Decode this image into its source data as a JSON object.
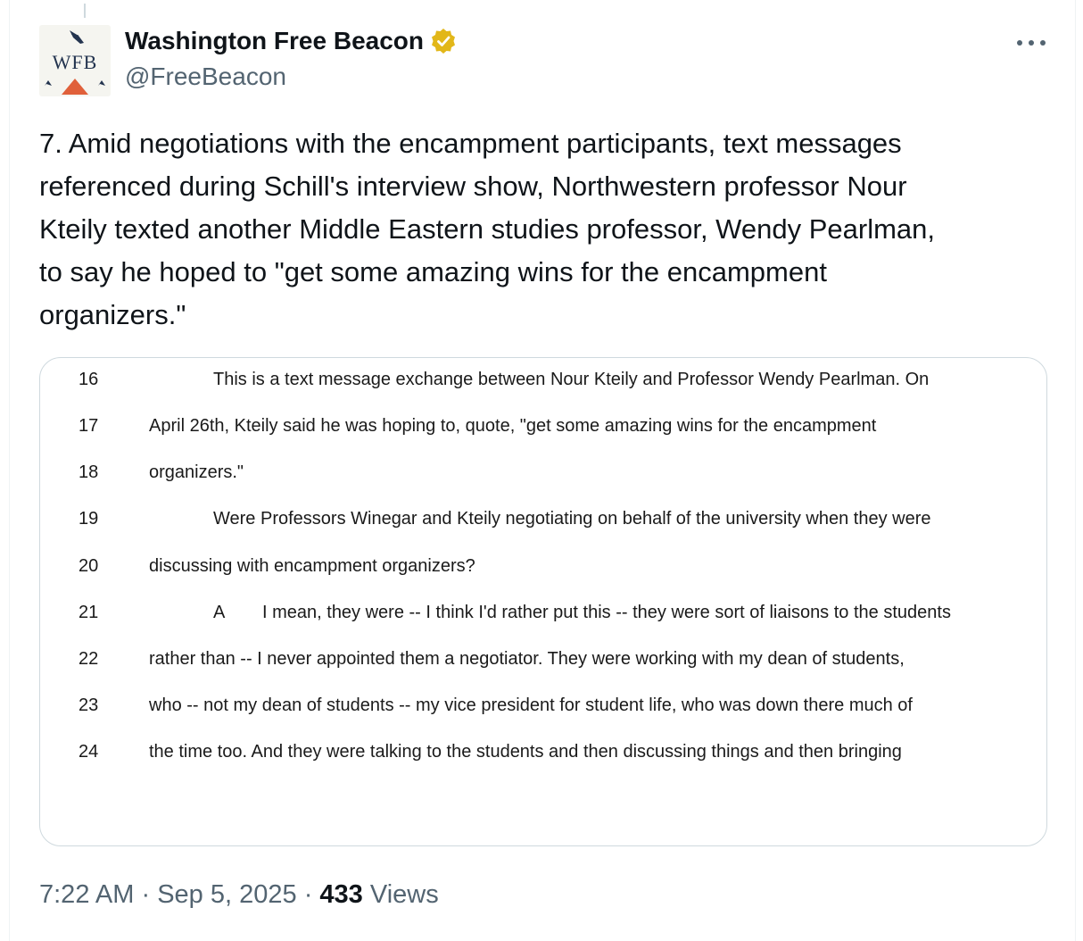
{
  "author": {
    "avatar_text": "WFB",
    "name": "Washington Free Beacon",
    "handle": "@FreeBeacon"
  },
  "tweet": {
    "text_lines": [
      "7. Amid negotiations with the encampment participants, text messages",
      "referenced during Schill's interview show, Northwestern professor Nour",
      "Kteily texted another Middle Eastern studies professor, Wendy Pearlman,",
      "to say he hoped to \"get some amazing wins for the encampment",
      "organizers.\""
    ]
  },
  "transcript": {
    "lines": [
      {
        "num": "16",
        "text": "This is a text message exchange between Nour Kteily and Professor Wendy Pearlman.  On"
      },
      {
        "num": "17",
        "text": "April 26th, Kteily said he was hoping to, quote, \"get some amazing wins for the encampment"
      },
      {
        "num": "18",
        "text": "organizers.\""
      },
      {
        "num": "19",
        "text": "Were Professors Winegar and Kteily negotiating on behalf of the university when they were"
      },
      {
        "num": "20",
        "text": "discussing with encampment organizers?"
      },
      {
        "num": "21",
        "speaker": "A",
        "text": "I mean, they were -- I think I'd rather put this -- they were sort of liaisons to the students"
      },
      {
        "num": "22",
        "text": "rather than -- I never appointed them a negotiator.  They were working with my dean of students,"
      },
      {
        "num": "23",
        "text": "who -- not my dean of students -- my vice president for student life, who was down there much of"
      },
      {
        "num": "24",
        "text": "the time too.  And they were talking to the students and then discussing things and then bringing"
      }
    ]
  },
  "meta": {
    "time": "7:22 AM",
    "date": "Sep 5, 2025",
    "views_count": "433",
    "views_label": "Views",
    "separator": "·"
  },
  "icons": {
    "verified": "verified-badge-icon",
    "more": "more-options-icon"
  },
  "colors": {
    "verified_badge": "#e2b719",
    "secondary_text": "#536471",
    "avatar_triangle": "#e0603a",
    "avatar_navy": "#23344f"
  }
}
